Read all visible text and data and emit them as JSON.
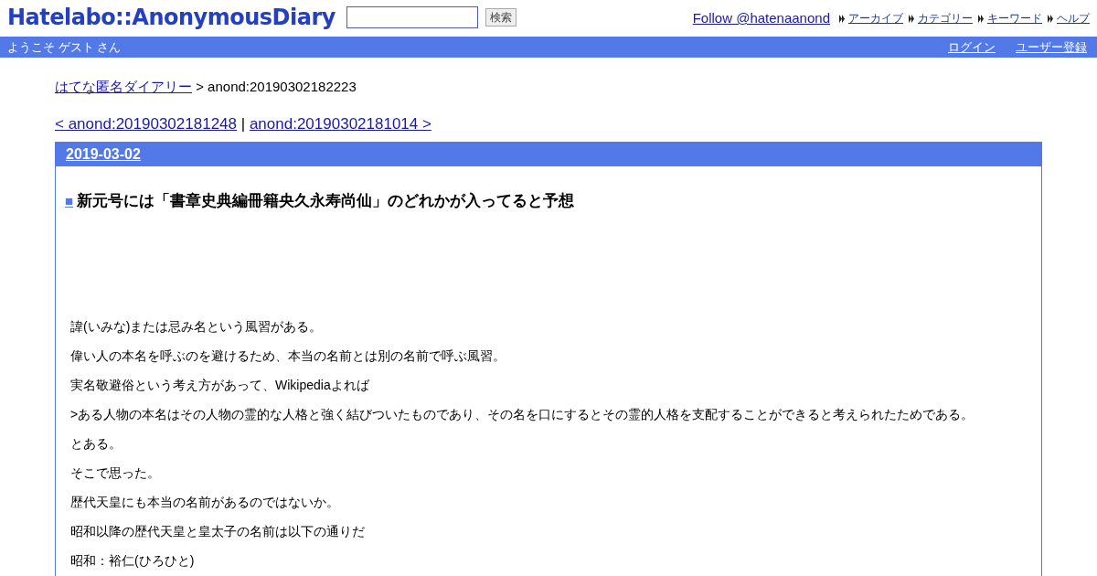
{
  "header": {
    "logo": "Hatelabo::AnonymousDiary",
    "search_button": "検索",
    "follow_link": "Follow @hatenaanond",
    "nav_links": [
      "アーカイブ",
      "カテゴリー",
      "キーワード",
      "ヘルプ"
    ]
  },
  "welcome_bar": {
    "greeting": "ようこそ ゲスト さん",
    "links": [
      "ログイン",
      "ユーザー登録"
    ]
  },
  "breadcrumb": {
    "link": "はてな匿名ダイアリー",
    "current": "> anond:20190302182223"
  },
  "pager": {
    "prev": "< anond:20190302181248",
    "separator": "|",
    "next": "anond:20190302181014 >"
  },
  "entry": {
    "date": "2019-03-02",
    "bullet": "■",
    "title": "新元号には「書章史典編冊籍央久永寿尚仙」のどれかが入ってると予想",
    "paragraphs": [
      "諱(いみな)または忌み名という風習がある。",
      "偉い人の本名を呼ぶのを避けるため、本当の名前とは別の名前で呼ぶ風習。",
      "実名敬避俗という考え方があって、Wikipediaよれば",
      ">ある人物の本名はその人物の霊的な人格と強く結びついたものであり、その名を口にするとその霊的人格を支配することができると考えられたためである。",
      "とある。",
      "そこで思った。",
      "歴代天皇にも本当の名前があるのではないか。",
      "昭和以降の歴代天皇と皇太子の名前は以下の通りだ",
      "昭和：裕仁(ひろひと)"
    ]
  }
}
